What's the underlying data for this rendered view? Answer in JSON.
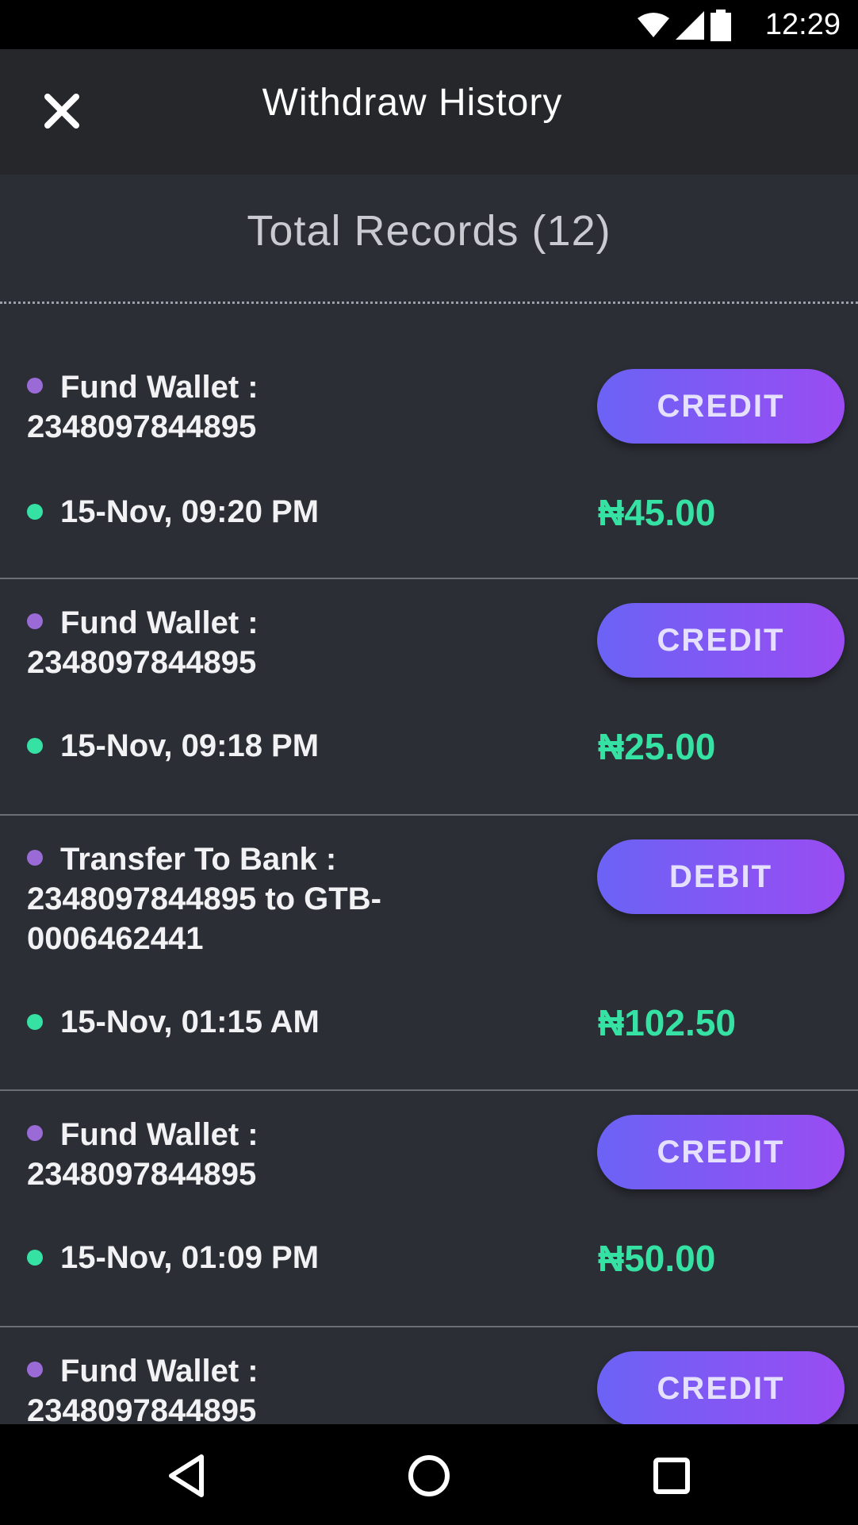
{
  "status_bar": {
    "time": "12:29",
    "icons": [
      "wifi-icon",
      "signal-icon",
      "battery-icon"
    ]
  },
  "app_bar": {
    "title": "Withdraw History",
    "close_icon": "close-icon"
  },
  "summary": {
    "text": "Total Records (12)"
  },
  "records": [
    {
      "description": "Fund Wallet : 2348097844895",
      "type": "CREDIT",
      "date": "15-Nov, 09:20 PM",
      "amount": "₦45.00"
    },
    {
      "description": "Fund Wallet : 2348097844895",
      "type": "CREDIT",
      "date": "15-Nov, 09:18 PM",
      "amount": "₦25.00"
    },
    {
      "description": "Transfer To Bank : 2348097844895 to GTB-0006462441",
      "type": "DEBIT",
      "date": "15-Nov, 01:15 AM",
      "amount": "₦102.50"
    },
    {
      "description": "Fund Wallet : 2348097844895",
      "type": "CREDIT",
      "date": "15-Nov, 01:09 PM",
      "amount": "₦50.00"
    },
    {
      "description": "Fund Wallet : 2348097844895",
      "type": "CREDIT",
      "date": "",
      "amount": ""
    }
  ],
  "colors": {
    "accent_gradient_start": "#6b63f5",
    "accent_gradient_end": "#9a4cf2",
    "amount_green": "#35e2a3",
    "dot_purple": "#9a6ad6",
    "background": "#2b2e35"
  },
  "nav": {
    "back_icon": "back-triangle-icon",
    "home_icon": "home-circle-icon",
    "recents_icon": "recents-square-icon"
  }
}
